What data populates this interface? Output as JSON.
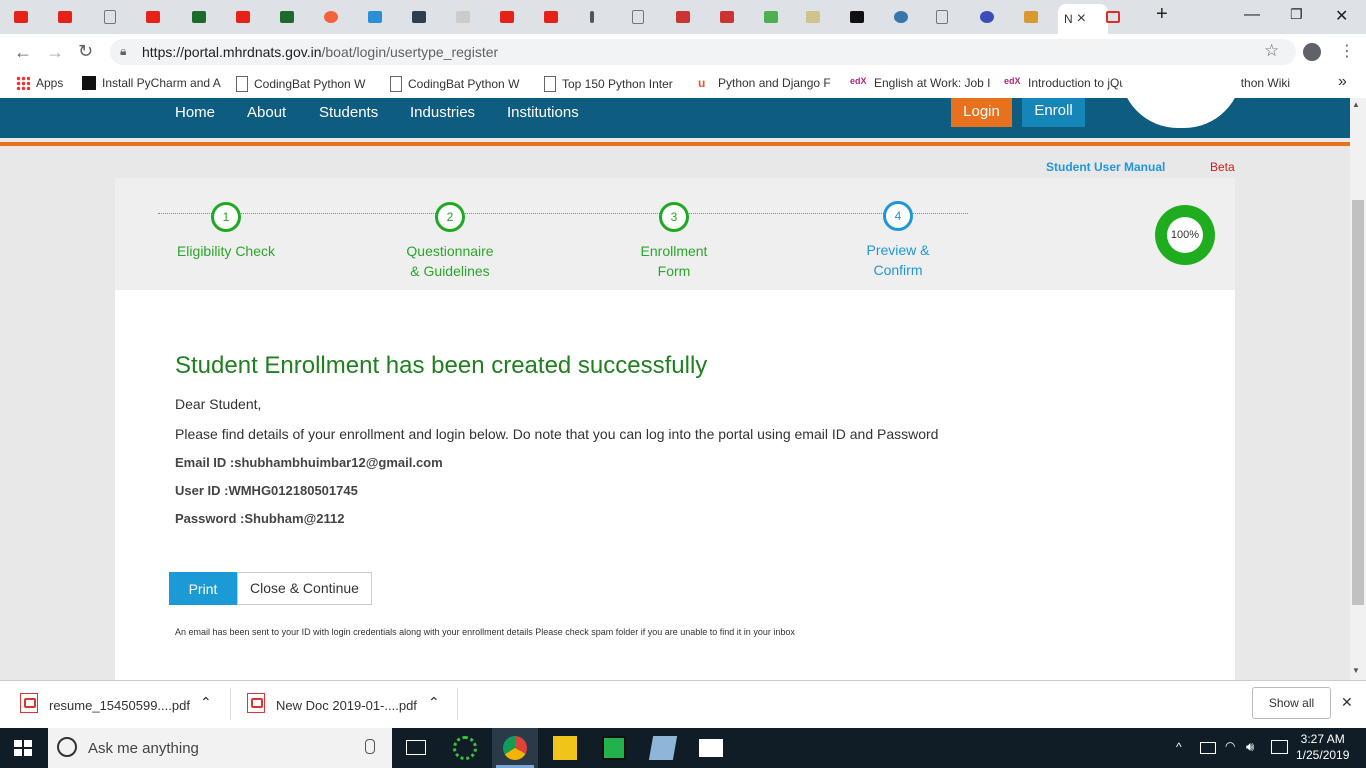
{
  "browser": {
    "active_tab_title": "N",
    "close_tab_glyph": "×",
    "new_tab_glyph": "+",
    "url_host": "https://portal.mhrdnats.gov.in",
    "url_path": "/boat/login/usertype_register",
    "bookmarks": [
      {
        "label": "Apps"
      },
      {
        "label": "Install PyCharm and A"
      },
      {
        "label": "CodingBat Python W"
      },
      {
        "label": "CodingBat Python W"
      },
      {
        "label": "Top 150 Python Inter"
      },
      {
        "label": "Python and Django F"
      },
      {
        "label": "English at Work: Job I"
      },
      {
        "label": "Introduction to jQuer"
      },
      {
        "label": "Django - Python Wiki"
      }
    ],
    "more_bookmarks_glyph": "»"
  },
  "site": {
    "nav": [
      "Home",
      "About",
      "Students",
      "Industries",
      "Institutions"
    ],
    "login_label": "Login",
    "enroll_label": "Enroll",
    "user_manual_label": "Student User Manual",
    "beta_label": "Beta",
    "steps": [
      {
        "num": "1",
        "line1": "Eligibility Check",
        "line2": "",
        "color": "#1fa91f"
      },
      {
        "num": "2",
        "line1": "Questionnaire",
        "line2": "& Guidelines",
        "color": "#1fa91f"
      },
      {
        "num": "3",
        "line1": "Enrollment",
        "line2": "Form",
        "color": "#1fa91f"
      },
      {
        "num": "4",
        "line1": "Preview &",
        "line2": "Confirm",
        "color": "#1f97d6"
      }
    ],
    "progress_label": "100%",
    "progress_value": 1.0,
    "heading": "Student Enrollment has been created successfully",
    "greeting": "Dear Student,",
    "intro": "Please find details of your enrollment and login below. Do note that you can log into the portal using email ID and Password",
    "email_line": "Email ID :shubhambhuimbar12@gmail.com",
    "userid_line": "User ID :WMHG012180501745",
    "password_line": "Password :Shubham@2112",
    "print_label": "Print",
    "close_continue_label": "Close & Continue",
    "note": "An email has been sent to your ID with login credentials along with your enrollment details Please check spam folder if you are unable to find it in your inbox"
  },
  "downloads": {
    "items": [
      "resume_15450599....pdf",
      "New Doc 2019-01-....pdf"
    ],
    "show_all_label": "Show all",
    "close_glyph": "✕"
  },
  "taskbar": {
    "search_placeholder": "Ask me anything",
    "time": "3:27 AM",
    "date": "1/25/2019"
  },
  "colors": {
    "nav_bg": "#0e5d80",
    "accent_orange": "#e8711e",
    "success_green": "#208020",
    "primary_blue": "#1c9ad6"
  }
}
